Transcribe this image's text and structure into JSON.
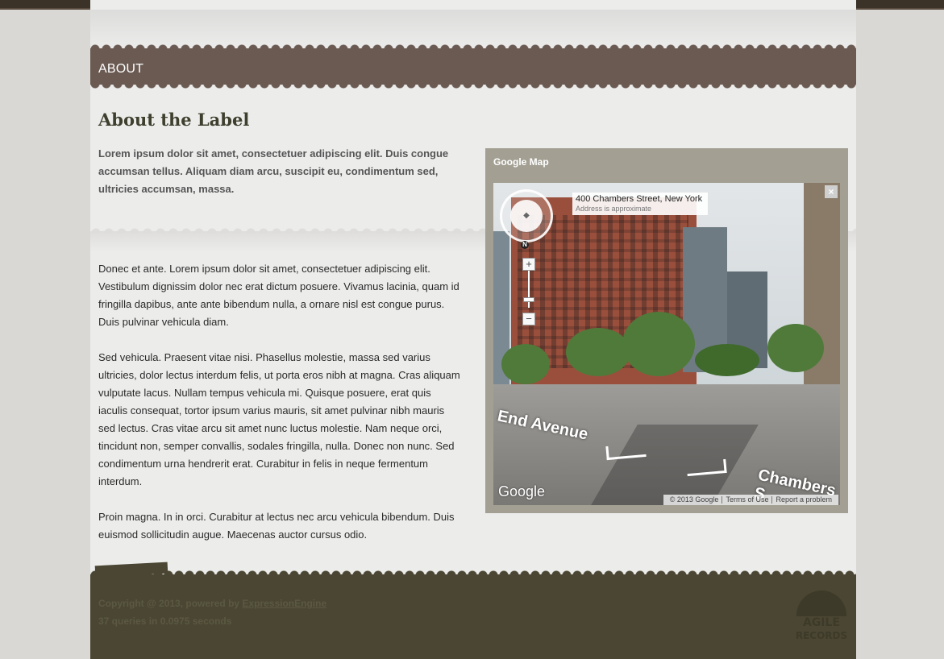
{
  "nav": {
    "title": "ABOUT"
  },
  "content": {
    "heading": "About the Label",
    "intro": "Lorem ipsum dolor sit amet, consectetuer adipiscing elit. Duis congue accumsan tellus. Aliquam diam arcu, suscipit eu, condimentum sed, ultricies accumsan, massa.",
    "paragraphs": [
      "Donec et ante. Lorem ipsum dolor sit amet, consectetuer adipiscing elit. Vestibulum dignissim dolor nec erat dictum posuere. Vivamus lacinia, quam id fringilla dapibus, ante ante bibendum nulla, a ornare nisl est congue purus. Duis pulvinar vehicula diam.",
      "Sed vehicula. Praesent vitae nisi. Phasellus molestie, massa sed varius ultricies, dolor lectus interdum felis, ut porta eros nibh at magna. Cras aliquam vulputate lacus. Nullam tempus vehicula mi. Quisque posuere, erat quis iaculis consequat, tortor ipsum varius mauris, sit amet pulvinar nibh mauris sed lectus. Cras vitae arcu sit amet nunc luctus molestie. Nam neque orci, tincidunt non, semper convallis, sodales fringilla, nulla. Donec non nunc. Sed condimentum urna hendrerit erat. Curabitur in felis in neque fermentum interdum.",
      "Proin magna. In in orci. Curabitur at lectus nec arcu vehicula bibendum. Duis euismod sollicitudin augue. Maecenas auctor cursus odio."
    ]
  },
  "map": {
    "title": "Google Map",
    "address": "400 Chambers Street, New York",
    "address_note": "Address is approximate",
    "street_labels": [
      "End Avenue",
      "Chambers S"
    ],
    "compass_label": "N",
    "zoom_in_label": "+",
    "zoom_out_label": "−",
    "close_label": "×",
    "logo": "Google",
    "attribution": {
      "copyright": "© 2013 Google",
      "terms": "Terms of Use",
      "report": "Report a problem"
    }
  },
  "footer": {
    "copyright_prefix": "Copyright @ 2013, powered by",
    "engine_link": "ExpressionEngine",
    "queries": "37 queries in 0.0975 seconds",
    "logo_line1": "AGILE",
    "logo_line2": "RECORDS"
  },
  "colors": {
    "nav_band": "#6a5a52",
    "footer": "#4a4633",
    "map_frame": "#a3a093",
    "heading": "#3f3f2e"
  }
}
